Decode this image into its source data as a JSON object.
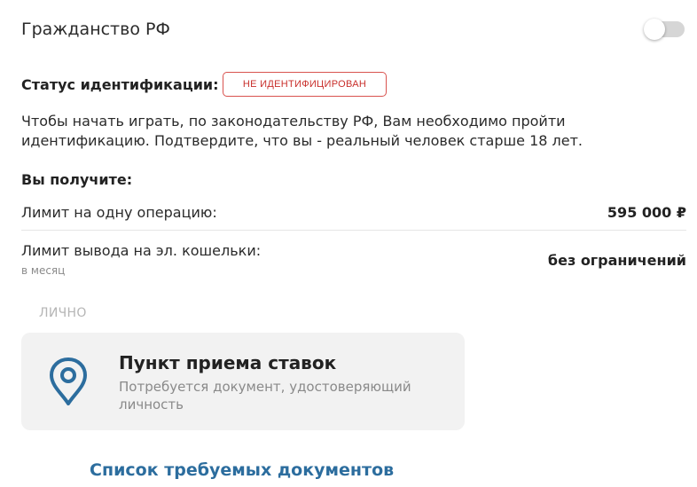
{
  "citizenship": {
    "label": "Гражданство РФ",
    "toggle_on": false
  },
  "status": {
    "label": "Статус идентификации:",
    "badge": "НЕ ИДЕНТИФИЦИРОВАН",
    "badge_color": "#d9534f"
  },
  "description": "Чтобы начать играть, по законодательству РФ, Вам необходимо пройти идентификацию. Подтвердите, что вы - реальный человек старше 18 лет.",
  "receive": {
    "title": "Вы получите:",
    "limits": [
      {
        "label": "Лимит на одну операцию:",
        "sublabel": "",
        "value": "595 000 ₽"
      },
      {
        "label": "Лимит вывода на эл. кошельки:",
        "sublabel": "в месяц",
        "value": "без ограничений"
      }
    ]
  },
  "personal": {
    "section_label": "ЛИЧНО",
    "card": {
      "icon": "location-pin-icon",
      "icon_color": "#2c6d9e",
      "title": "Пункт приема ставок",
      "description": "Потребуется документ, удостоверяющий личность"
    }
  },
  "docs_link": "Список требуемых документов"
}
